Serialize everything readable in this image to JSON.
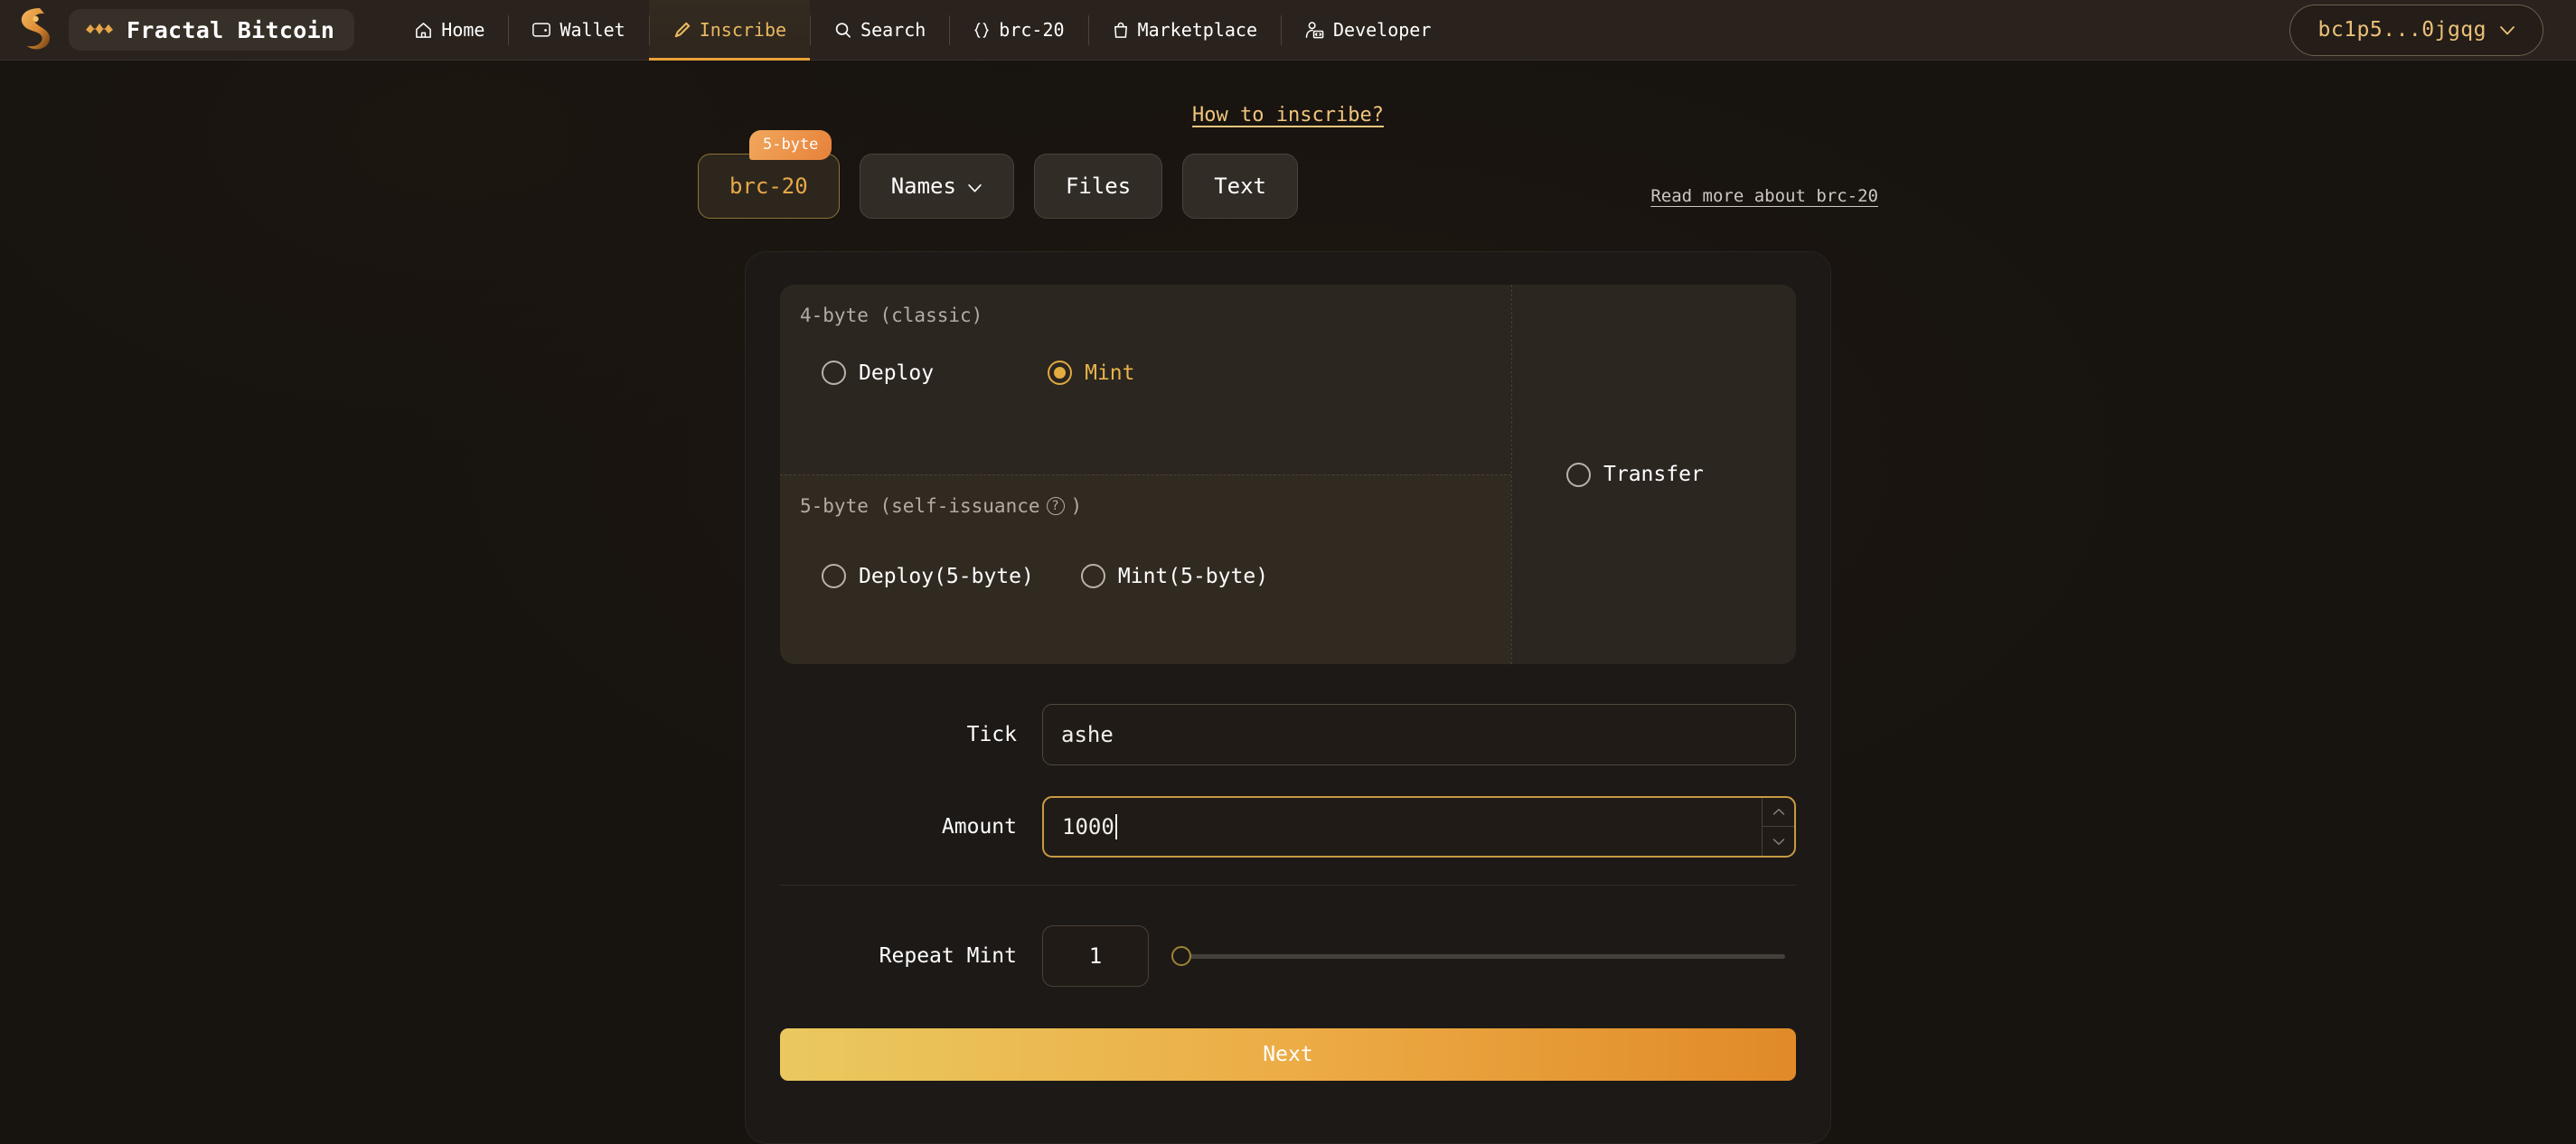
{
  "navbar": {
    "logo_icon": "fractal-s-logo",
    "brand": {
      "icon": "fractal-chevron-logo",
      "label": "Fractal Bitcoin"
    },
    "items": [
      {
        "label": "Home",
        "icon": "home-icon",
        "active": false
      },
      {
        "label": "Wallet",
        "icon": "wallet-icon",
        "active": false
      },
      {
        "label": "Inscribe",
        "icon": "pencil-icon",
        "active": true
      },
      {
        "label": "Search",
        "icon": "search-icon",
        "active": false
      },
      {
        "label": "brc-20",
        "icon": "braces-icon",
        "active": false
      },
      {
        "label": "Marketplace",
        "icon": "bag-icon",
        "active": false
      },
      {
        "label": "Developer",
        "icon": "developer-icon",
        "active": false
      }
    ],
    "wallet": {
      "address": "bc1p5...0jgqg",
      "chevron_icon": "chevron-down-icon"
    }
  },
  "page": {
    "how_to_link": "How to inscribe?",
    "read_more_link": "Read more about brc-20"
  },
  "tabs": {
    "badge": "5-byte",
    "items": [
      {
        "label": "brc-20",
        "selected": true,
        "has_chevron": false
      },
      {
        "label": "Names",
        "selected": false,
        "has_chevron": true
      },
      {
        "label": "Files",
        "selected": false,
        "has_chevron": false
      },
      {
        "label": "Text",
        "selected": false,
        "has_chevron": false
      }
    ]
  },
  "mode_panel": {
    "classic": {
      "title": "4-byte (classic)",
      "options": [
        {
          "label": "Deploy",
          "selected": false
        },
        {
          "label": "Mint",
          "selected": true
        }
      ]
    },
    "self_issuance": {
      "title": "5-byte (self-issuance",
      "title_suffix": ")",
      "help_icon": "question-mark-icon",
      "options": [
        {
          "label": "Deploy(5-byte)",
          "selected": false
        },
        {
          "label": "Mint(5-byte)",
          "selected": false
        }
      ]
    },
    "transfer": {
      "label": "Transfer",
      "selected": false
    }
  },
  "form": {
    "tick": {
      "label": "Tick",
      "value": "ashe",
      "placeholder": ""
    },
    "amount": {
      "label": "Amount",
      "value": "1000",
      "placeholder": "",
      "focused": true,
      "stepper_up_icon": "chevron-up-icon",
      "stepper_down_icon": "chevron-down-icon"
    },
    "repeat_mint": {
      "label": "Repeat Mint",
      "value": "1",
      "slider_min": "1",
      "slider_position_percent": 0
    },
    "next_button": "Next"
  },
  "colors": {
    "accent": "#e9a13b",
    "accent_light": "#eac95f",
    "badge_gradient_start": "#f0a85c",
    "badge_gradient_end": "#e8813a",
    "page_bg": "#17130f",
    "card_bg": "#1d1916",
    "navbar_bg": "#2a231d"
  }
}
